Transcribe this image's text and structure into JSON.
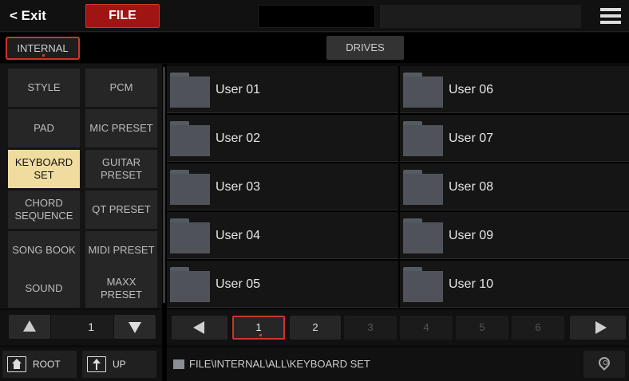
{
  "topbar": {
    "exit_label": "< Exit",
    "file_label": "FILE",
    "menu_icon": "hamburger-menu-icon"
  },
  "source": {
    "internal_label": "INTERNAL",
    "drives_label": "DRIVES"
  },
  "categories": [
    {
      "label": "STYLE"
    },
    {
      "label": "PCM"
    },
    {
      "label": "PAD"
    },
    {
      "label": "MIC PRESET"
    },
    {
      "label": "KEYBOARD SET",
      "selected": true
    },
    {
      "label": "GUITAR PRESET"
    },
    {
      "label": "CHORD SEQUENCE"
    },
    {
      "label": "QT PRESET"
    },
    {
      "label": "SONG BOOK"
    },
    {
      "label": "MIDI PRESET"
    },
    {
      "label": "SOUND"
    },
    {
      "label": "MAXX PRESET"
    }
  ],
  "folders": [
    "User 01",
    "User 02",
    "User 03",
    "User 04",
    "User 05",
    "User 06",
    "User 07",
    "User 08",
    "User 09",
    "User 10"
  ],
  "category_pager": {
    "value": "1"
  },
  "nav": {
    "root_label": "ROOT",
    "up_label": "UP"
  },
  "pages": [
    "1",
    "2",
    "3",
    "4",
    "5",
    "6"
  ],
  "current_page": "1",
  "path": "FILE\\INTERNAL\\ALL\\KEYBOARD SET",
  "colors": {
    "accent_red": "#a01414",
    "selected_yellow": "#f1dca0",
    "folder_gray": "#4f5359"
  }
}
